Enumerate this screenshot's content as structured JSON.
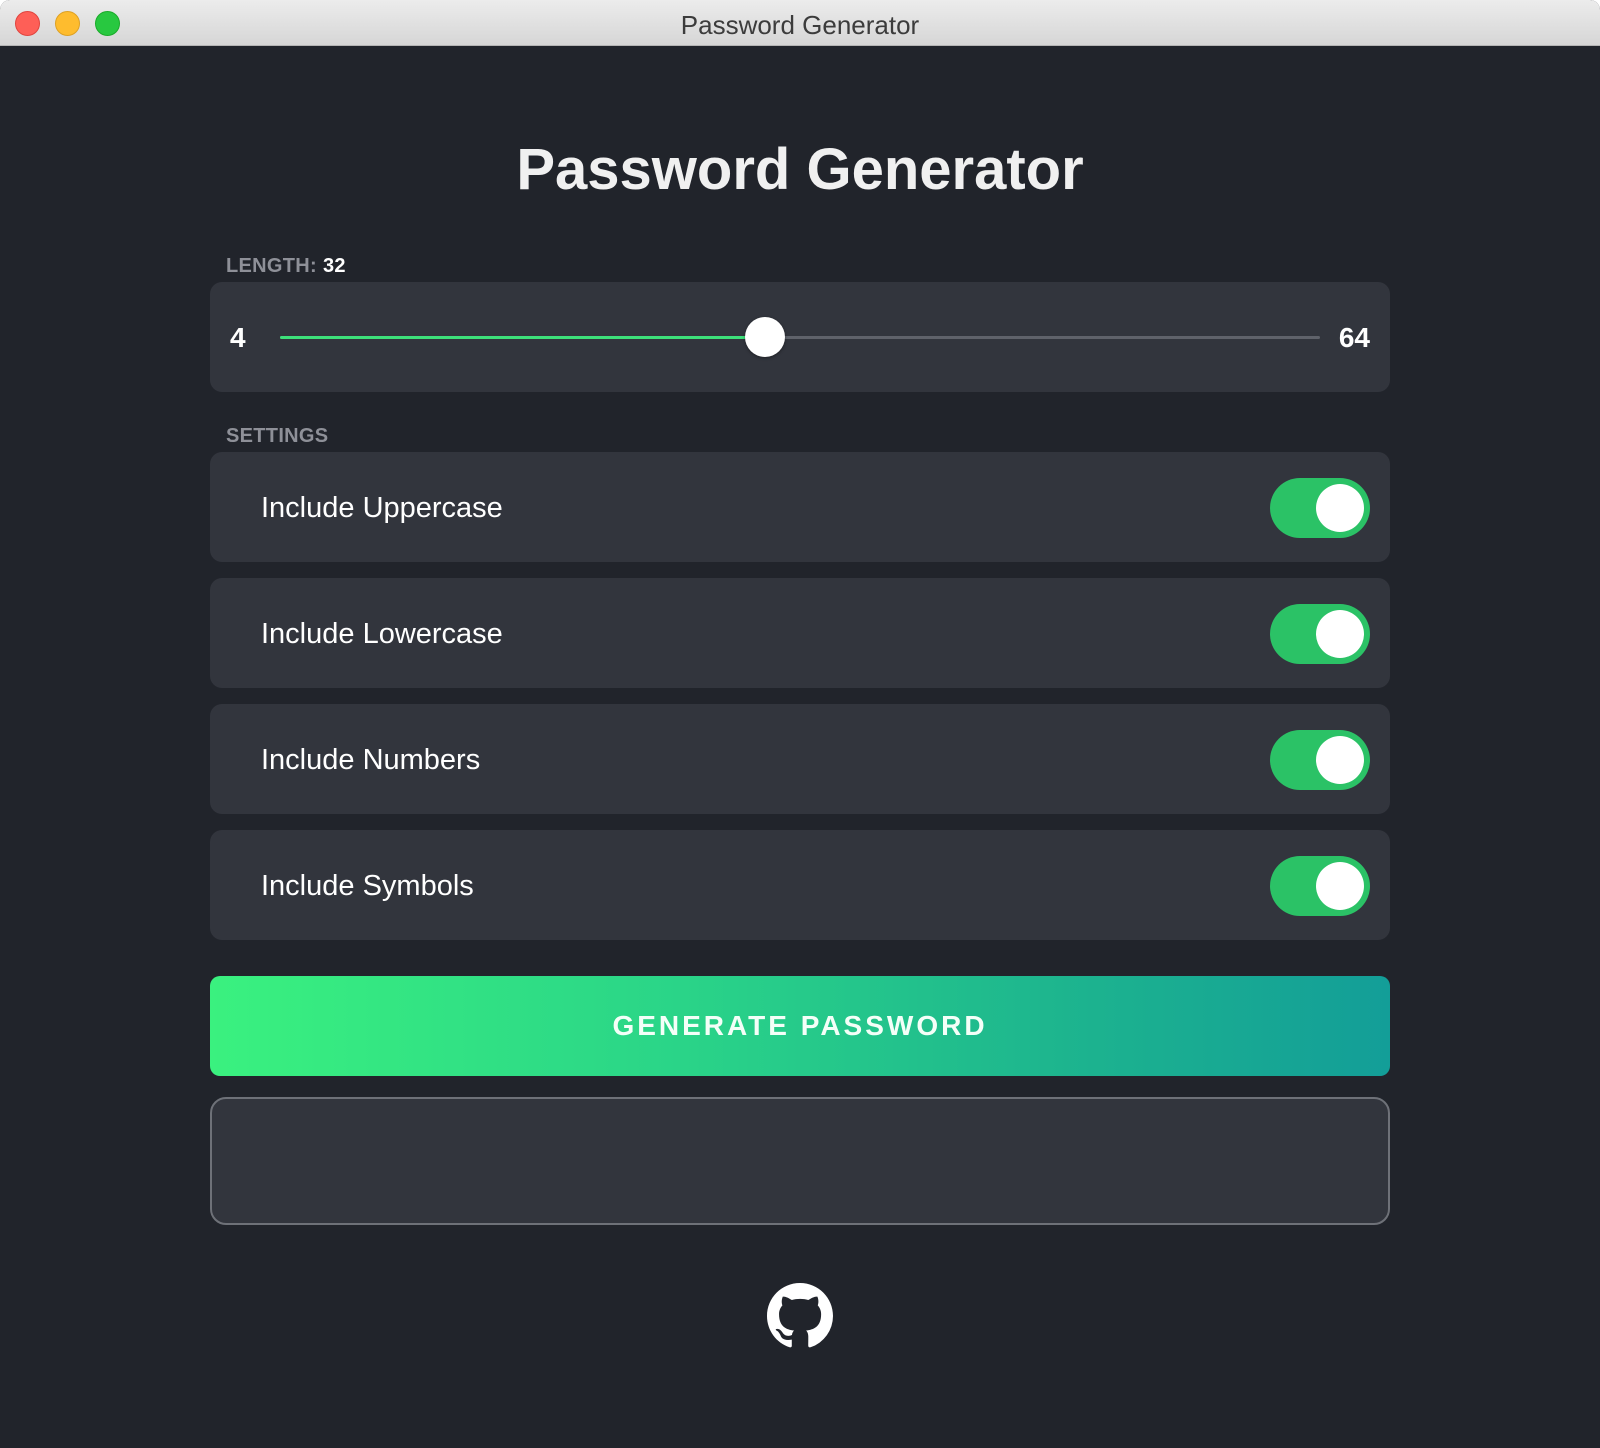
{
  "window": {
    "title": "Password Generator"
  },
  "app": {
    "title": "Password Generator"
  },
  "length": {
    "label": "LENGTH:",
    "value": "32",
    "min_label": "4",
    "max_label": "64",
    "min": 4,
    "max": 64,
    "current": 32
  },
  "settings": {
    "label": "SETTINGS",
    "items": [
      {
        "label": "Include Uppercase",
        "enabled": true
      },
      {
        "label": "Include Lowercase",
        "enabled": true
      },
      {
        "label": "Include Numbers",
        "enabled": true
      },
      {
        "label": "Include Symbols",
        "enabled": true
      }
    ]
  },
  "generate_button": {
    "label": "GENERATE PASSWORD"
  },
  "output": {
    "value": ""
  },
  "footer": {
    "icon": "github-icon"
  },
  "colors": {
    "accent": "#3de07a",
    "toggle_on": "#2bc266",
    "gradient_start": "#3af17f",
    "gradient_end": "#139e98",
    "background": "#21242b",
    "panel": "#32353d"
  }
}
